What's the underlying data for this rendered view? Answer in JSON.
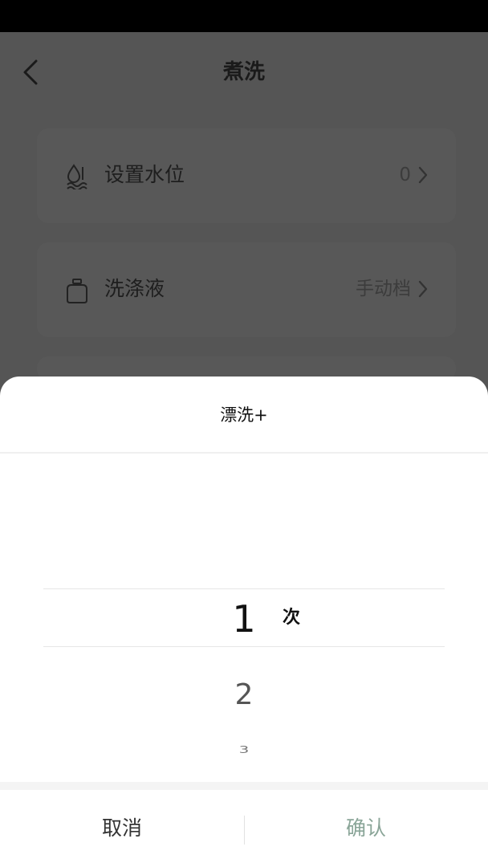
{
  "header": {
    "title": "煮洗"
  },
  "settings": [
    {
      "label": "设置水位",
      "value": "0",
      "icon": "water-level-icon"
    },
    {
      "label": "洗涤液",
      "value": "手动档",
      "icon": "detergent-bottle-icon"
    }
  ],
  "sheet": {
    "title": "漂洗+",
    "picker": {
      "selected": "1",
      "unit": "次",
      "options": [
        "1",
        "2",
        "3"
      ]
    },
    "cancel_label": "取消",
    "confirm_label": "确认"
  },
  "colors": {
    "confirm": "#8aa598",
    "overlay": "#555555"
  }
}
